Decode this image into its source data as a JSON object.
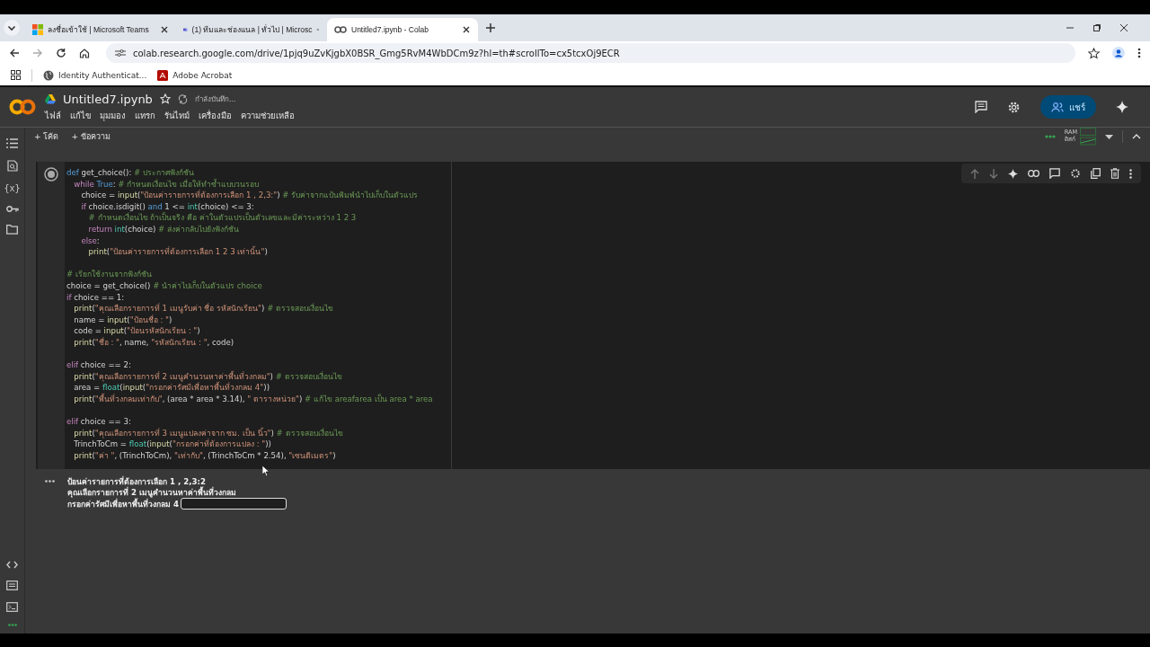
{
  "browser": {
    "tabs": [
      {
        "title": "ลงชื่อเข้าใช้ | Microsoft Teams",
        "selected": false
      },
      {
        "title": "(1) ทีมและช่องแนล | ทั่วไป | Microsc",
        "selected": false
      },
      {
        "title": "Untitled7.ipynb - Colab",
        "selected": true
      }
    ],
    "url": "colab.research.google.com/drive/1pjq9uZvKjgbX0BSR_Gmg5RvM4WbDCm9z?hl=th#scrollTo=cx5tcxOj9ECR",
    "bookmarks": [
      "Identity Authenticat...",
      "Adobe Acrobat"
    ]
  },
  "colab": {
    "title": "Untitled7.ipynb",
    "save_status": "กำลังบันทึก...",
    "starred": false,
    "menu": [
      "ไฟล์",
      "แก้ไข",
      "มุมมอง",
      "แทรก",
      "รันไทม์",
      "เครื่องมือ",
      "ความช่วยเหลือ"
    ],
    "share": "แชร์",
    "toolbar": [
      "+ โค้ด",
      "+ ข้อความ"
    ],
    "resources": {
      "ram": "RAM",
      "disk": "ดิสก์"
    },
    "sidebar_var": "{x}"
  },
  "cell": {
    "blocks": [
      [
        [
          {
            "t": "def",
            "kind": "kw"
          },
          {
            "t": " get_choice(): ",
            "kind": "plain"
          },
          {
            "t": "# ประกาศฟังก์ชัน",
            "kind": "comment"
          }
        ],
        [
          {
            "t": "   while",
            "kind": "ctrl"
          },
          {
            "t": " True",
            "kind": "kw"
          },
          {
            "t": ": ",
            "kind": "plain"
          },
          {
            "t": "# กำหนดเงื่อนไข เมื่อให้ทำซ้ำแบบวนรอบ",
            "kind": "comment"
          }
        ],
        [
          {
            "t": "      choice = ",
            "kind": "plain"
          },
          {
            "t": "input",
            "kind": "fn"
          },
          {
            "t": "(",
            "kind": "plain"
          },
          {
            "t": "\"ป้อนค่ารายการที่ต้องการเลือก 1 , 2,3:\"",
            "kind": "str"
          },
          {
            "t": ") ",
            "kind": "plain"
          },
          {
            "t": "# รับค่าจากแป้นพิมพ์นำไปเก็บในตัวแปร",
            "kind": "comment"
          }
        ],
        [
          {
            "t": "      if",
            "kind": "ctrl"
          },
          {
            "t": " choice.isdigit() ",
            "kind": "plain"
          },
          {
            "t": "and",
            "kind": "kw"
          },
          {
            "t": " 1 <= ",
            "kind": "plain"
          },
          {
            "t": "int",
            "kind": "builtin"
          },
          {
            "t": "(choice) <= 3:",
            "kind": "plain"
          }
        ],
        [
          {
            "t": "         # กำหนดเงื่อนไข ถ้าเป็นจริง คือ ค่าในตัวแปรเป็นตัวเลขและมีค่าระหว่าง 1 2 3",
            "kind": "comment"
          }
        ],
        [
          {
            "t": "         return",
            "kind": "ctrl"
          },
          {
            "t": " int",
            "kind": "builtin"
          },
          {
            "t": "(choice) ",
            "kind": "plain"
          },
          {
            "t": "# ส่งค่ากลับไปยังฟังก์ชัน",
            "kind": "comment"
          }
        ],
        [
          {
            "t": "      else",
            "kind": "ctrl"
          },
          {
            "t": ":",
            "kind": "plain"
          }
        ],
        [
          {
            "t": "         print",
            "kind": "fn"
          },
          {
            "t": "(",
            "kind": "plain"
          },
          {
            "t": "\"ป้อนค่ารายการที่ต้องการเลือก 1 2 3 เท่านั้น\"",
            "kind": "str"
          },
          {
            "t": ")",
            "kind": "plain"
          }
        ]
      ],
      [
        [
          {
            "t": "# เรียกใช้งานจากฟังก์ชัน",
            "kind": "comment"
          }
        ],
        [
          {
            "t": "choice = get_choice() ",
            "kind": "plain"
          },
          {
            "t": "# นำค่าไปเก็บในตัวแปร choice",
            "kind": "comment"
          }
        ],
        [
          {
            "t": "if",
            "kind": "ctrl"
          },
          {
            "t": " choice == 1:",
            "kind": "plain"
          }
        ],
        [
          {
            "t": "   print",
            "kind": "fn"
          },
          {
            "t": "(",
            "kind": "plain"
          },
          {
            "t": "\"คุณเลือกรายการที่ 1 เมนูรับค่า ชื่อ รหัสนักเรียน\"",
            "kind": "str"
          },
          {
            "t": ") ",
            "kind": "plain"
          },
          {
            "t": "# ตรวจสอบเงื่อนไข",
            "kind": "comment"
          }
        ],
        [
          {
            "t": "   name = ",
            "kind": "plain"
          },
          {
            "t": "input",
            "kind": "fn"
          },
          {
            "t": "(",
            "kind": "plain"
          },
          {
            "t": "\"ป้อนชื่อ : \"",
            "kind": "str"
          },
          {
            "t": ")",
            "kind": "plain"
          }
        ],
        [
          {
            "t": "   code = ",
            "kind": "plain"
          },
          {
            "t": "input",
            "kind": "fn"
          },
          {
            "t": "(",
            "kind": "plain"
          },
          {
            "t": "\"ป้อนรหัสนักเรียน : \"",
            "kind": "str"
          },
          {
            "t": ")",
            "kind": "plain"
          }
        ],
        [
          {
            "t": "   print",
            "kind": "fn"
          },
          {
            "t": "(",
            "kind": "plain"
          },
          {
            "t": "\"ชื่อ : \"",
            "kind": "str"
          },
          {
            "t": ", name, ",
            "kind": "plain"
          },
          {
            "t": "\"รหัสนักเรียน : \"",
            "kind": "str"
          },
          {
            "t": ", code)",
            "kind": "plain"
          }
        ]
      ],
      [
        [
          {
            "t": "elif",
            "kind": "ctrl"
          },
          {
            "t": " choice == 2:",
            "kind": "plain"
          }
        ],
        [
          {
            "t": "   print",
            "kind": "fn"
          },
          {
            "t": "(",
            "kind": "plain"
          },
          {
            "t": "\"คุณเลือกรายการที่ 2 เมนูคำนวนหาค่าพื้นที่วงกลม\"",
            "kind": "str"
          },
          {
            "t": ") ",
            "kind": "plain"
          },
          {
            "t": "# ตรวจสอบเงื่อนไข",
            "kind": "comment"
          }
        ],
        [
          {
            "t": "   area = ",
            "kind": "plain"
          },
          {
            "t": "float",
            "kind": "builtin"
          },
          {
            "t": "(",
            "kind": "plain"
          },
          {
            "t": "input",
            "kind": "fn"
          },
          {
            "t": "(",
            "kind": "plain"
          },
          {
            "t": "\"กรอกค่ารัศมีเพื่อหาพื้นที่วงกลม 4\"",
            "kind": "str"
          },
          {
            "t": "))",
            "kind": "plain"
          }
        ],
        [
          {
            "t": "   print",
            "kind": "fn"
          },
          {
            "t": "(",
            "kind": "plain"
          },
          {
            "t": "\"พื้นที่วงกลมเท่ากับ\"",
            "kind": "str"
          },
          {
            "t": ", (area * area * 3.14), ",
            "kind": "plain"
          },
          {
            "t": "\" ตารางหน่วย\"",
            "kind": "str"
          },
          {
            "t": ") ",
            "kind": "plain"
          },
          {
            "t": "# แก้ไข areafarea เป็น area * area",
            "kind": "comment"
          }
        ]
      ],
      [
        [
          {
            "t": "elif",
            "kind": "ctrl"
          },
          {
            "t": " choice == 3:",
            "kind": "plain"
          }
        ],
        [
          {
            "t": "   print",
            "kind": "fn"
          },
          {
            "t": "(",
            "kind": "plain"
          },
          {
            "t": "\"คุณเลือกรายการที่ 3 เมนูแปลงค่าจาก ซม. เป็น นิ้ว\"",
            "kind": "str"
          },
          {
            "t": ") ",
            "kind": "plain"
          },
          {
            "t": "# ตรวจสอบเงื่อนไข",
            "kind": "comment"
          }
        ],
        [
          {
            "t": "   TrinchToCm = ",
            "kind": "plain"
          },
          {
            "t": "float",
            "kind": "builtin"
          },
          {
            "t": "(",
            "kind": "plain"
          },
          {
            "t": "input",
            "kind": "fn"
          },
          {
            "t": "(",
            "kind": "plain"
          },
          {
            "t": "\"กรอกค่าที่ต้องการแปลง : \"",
            "kind": "str"
          },
          {
            "t": "))",
            "kind": "plain"
          }
        ],
        [
          {
            "t": "   print",
            "kind": "fn"
          },
          {
            "t": "(",
            "kind": "plain"
          },
          {
            "t": "\"ค่า \"",
            "kind": "str"
          },
          {
            "t": ", (TrinchToCm), ",
            "kind": "plain"
          },
          {
            "t": "\"เท่ากับ\"",
            "kind": "str"
          },
          {
            "t": ", (TrinchToCm * 2.54), ",
            "kind": "plain"
          },
          {
            "t": "\"เซนติเมตร\"",
            "kind": "str"
          },
          {
            "t": ")",
            "kind": "plain"
          }
        ]
      ]
    ],
    "output": [
      "ป้อนค่ารายการที่ต้องการเลือก 1 , 2,3:2",
      "คุณเลือกรายการที่ 2 เมนูคำนวนหาค่าพื้นที่วงกลม"
    ],
    "prompt": "กรอกค่ารัศมีเพื่อหาพื้นที่วงกลม 4"
  }
}
